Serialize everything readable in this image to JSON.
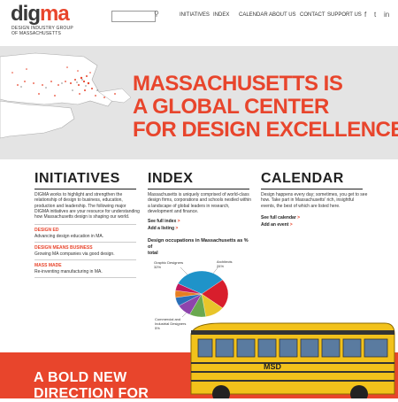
{
  "logo": {
    "dig": "dig",
    "ma": "ma",
    "subtitle_line1": "DESIGN INDUSTRY GROUP",
    "subtitle_line2": "OF MASSACHUSETTS"
  },
  "search": {
    "placeholder": ""
  },
  "nav": [
    "INITIATIVES",
    "INDEX",
    "CALENDAR",
    "ABOUT US",
    "CONTACT",
    "SUPPORT US"
  ],
  "social": [
    "f",
    "t",
    "in"
  ],
  "hero": {
    "lines": [
      "MASSACHUSETTS IS",
      "A GLOBAL CENTER",
      "FOR DESIGN EXCELLENCE >"
    ]
  },
  "initiatives": {
    "title": "INITIATIVES",
    "body": [
      "DIGMA works to highlight and strengthen the",
      "relationship of design to business, education,",
      "production and leadership. The following major",
      "DIGMA initiatives are your resource for understanding",
      "how Massachusetts design is shaping our world."
    ],
    "items": [
      {
        "title": "DESIGN ED",
        "desc": "Advancing design education in MA."
      },
      {
        "title": "DESIGN MEANS BUSINESS",
        "desc": "Growing MA companies via good design."
      },
      {
        "title": "MASS MADE",
        "desc": "Re-inventing manufacturing in MA."
      }
    ]
  },
  "index": {
    "title": "INDEX",
    "body": [
      "Massachusetts is uniquely comprised of world-class",
      "design firms, corporations and schools nestled within",
      "a landscape of global leaders in research,",
      "development and finance."
    ],
    "link1": "See full index",
    "link2": "Add a listing",
    "arrow": ">",
    "chart_title_line1": "Design occupations in Massachusetts as % of",
    "chart_title_line2": "total"
  },
  "calendar": {
    "title": "CALENDAR",
    "body": [
      "Design happens every day; sometimes, you get to see",
      "how. Take part in Massachusetts' rich, insightful",
      "events, the best of which are listed here."
    ],
    "link1": "See full calendar",
    "link2": "Add an event",
    "arrow": ">"
  },
  "chart_data": {
    "type": "pie",
    "title": "Design occupations in Massachusetts as % of total",
    "labels_shown": [
      "Graphic Designers 32%",
      "Architects 21%",
      "Commercial and Industrial Designers 5%"
    ],
    "slices": [
      {
        "name": "Graphic Designers",
        "value": 32,
        "color": "#1f93c9"
      },
      {
        "name": "Architects",
        "value": 21,
        "color": "#d81e2c"
      },
      {
        "name": "",
        "value": 12,
        "color": "#e8c52a"
      },
      {
        "name": "",
        "value": 10,
        "color": "#6aa84f"
      },
      {
        "name": "",
        "value": 9,
        "color": "#8e44ad"
      },
      {
        "name": "",
        "value": 6,
        "color": "#2a6fb8"
      },
      {
        "name": "Commercial and Industrial Designers",
        "value": 5,
        "color": "#e67e22"
      },
      {
        "name": "",
        "value": 5,
        "color": "#c2185b"
      }
    ]
  },
  "pie_labels": {
    "graphic": [
      "Graphic Designers",
      "32%"
    ],
    "architects": [
      "Architects",
      "21%"
    ],
    "commercial": [
      "Commercial and",
      "Industrial Designers",
      "5%"
    ]
  },
  "bottom": {
    "lines": [
      "A BOLD NEW",
      "DIRECTION FOR"
    ],
    "bus_text": "MSD"
  }
}
